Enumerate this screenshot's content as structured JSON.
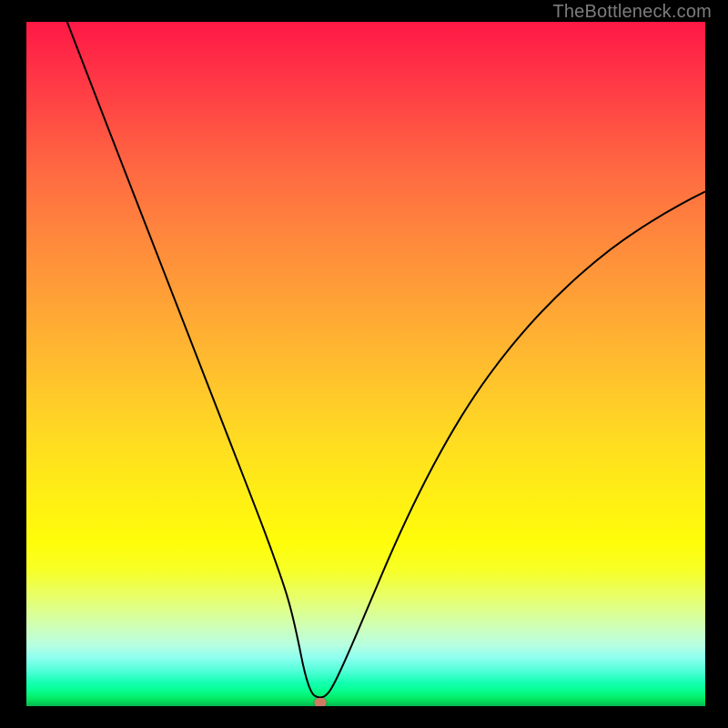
{
  "watermark": "TheBottleneck.com",
  "chart_data": {
    "type": "line",
    "title": "",
    "xlabel": "",
    "ylabel": "",
    "xlim": [
      0,
      100
    ],
    "ylim": [
      0,
      100
    ],
    "grid": false,
    "legend": false,
    "background_gradient": {
      "top": "#ff1846",
      "mid": "#ffde20",
      "bottom": "#03b84f"
    },
    "series": [
      {
        "name": "bottleneck-curve",
        "color": "#000000",
        "x": [
          6,
          10,
          14,
          18,
          22,
          26,
          30,
          34,
          36,
          38,
          39,
          40,
          41,
          42,
          43,
          44,
          45,
          47,
          50,
          54,
          58,
          62,
          66,
          70,
          74,
          78,
          82,
          86,
          90,
          94,
          98,
          100
        ],
        "y": [
          100,
          89.6,
          79.3,
          69.0,
          58.7,
          48.4,
          38.1,
          27.8,
          22.5,
          16.8,
          13.4,
          9.0,
          4.0,
          1.0,
          0.4,
          0.6,
          1.8,
          6.0,
          13.0,
          22.5,
          31.0,
          38.5,
          45.0,
          50.5,
          55.3,
          59.5,
          63.2,
          66.5,
          69.3,
          71.8,
          74.0,
          75.0
        ]
      }
    ],
    "markers": [
      {
        "name": "optimal-point",
        "x": 43.3,
        "y": 0.5,
        "color": "#cf7b62"
      }
    ]
  }
}
